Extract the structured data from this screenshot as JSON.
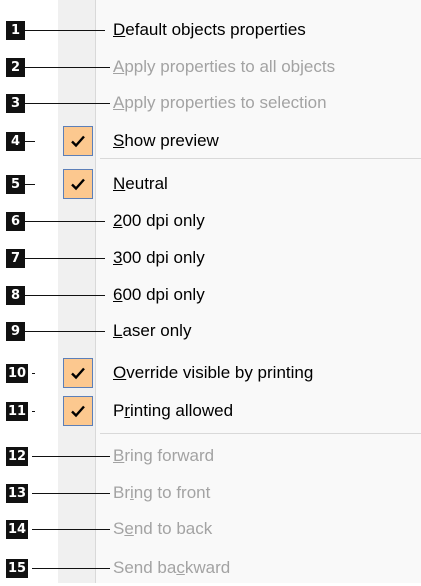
{
  "colors": {
    "menu_bg": "#f9f9f9",
    "gutter_bg": "#f0f0f0",
    "check_bg": "#fcc88f",
    "check_border": "#5c7fb8",
    "disabled_text": "#a3a3a3",
    "badge_bg": "#111111"
  },
  "menu": {
    "items": [
      {
        "label": "Default objects properties",
        "mnemonic_index": 0,
        "disabled": false,
        "checked": false,
        "callout": "1"
      },
      {
        "label": "Apply properties to all objects",
        "mnemonic_index": 0,
        "disabled": true,
        "checked": false,
        "callout": "2"
      },
      {
        "label": "Apply properties to selection",
        "mnemonic_index": 0,
        "disabled": true,
        "checked": false,
        "callout": "3"
      },
      {
        "label": "Show preview",
        "mnemonic_index": 0,
        "disabled": false,
        "checked": true,
        "callout": "4"
      },
      {
        "label": "Neutral",
        "mnemonic_index": 0,
        "disabled": false,
        "checked": true,
        "callout": "5"
      },
      {
        "label": "200 dpi only",
        "mnemonic_index": 0,
        "disabled": false,
        "checked": false,
        "callout": "6"
      },
      {
        "label": "300 dpi only",
        "mnemonic_index": 0,
        "disabled": false,
        "checked": false,
        "callout": "7"
      },
      {
        "label": "600 dpi only",
        "mnemonic_index": 0,
        "disabled": false,
        "checked": false,
        "callout": "8"
      },
      {
        "label": "Laser only",
        "mnemonic_index": 0,
        "disabled": false,
        "checked": false,
        "callout": "9"
      },
      {
        "label": "Override visible by printing",
        "mnemonic_index": 0,
        "disabled": false,
        "checked": true,
        "callout": "10"
      },
      {
        "label": "Printing allowed",
        "mnemonic_index": 1,
        "disabled": false,
        "checked": true,
        "callout": "11"
      },
      {
        "label": "Bring forward",
        "mnemonic_index": 0,
        "disabled": true,
        "checked": false,
        "callout": "12"
      },
      {
        "label": "Bring to front",
        "mnemonic_index": 2,
        "disabled": true,
        "checked": false,
        "callout": "13"
      },
      {
        "label": "Send to back",
        "mnemonic_index": 1,
        "disabled": true,
        "checked": false,
        "callout": "14"
      },
      {
        "label": "Send backward",
        "mnemonic_index": 7,
        "disabled": true,
        "checked": false,
        "callout": "15"
      }
    ],
    "check_icon": "checkmark-icon"
  }
}
